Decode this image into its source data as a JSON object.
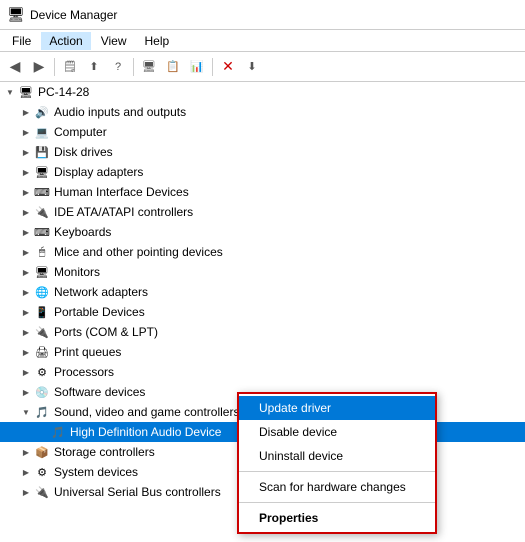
{
  "titleBar": {
    "icon": "🖥",
    "title": "Device Manager"
  },
  "menuBar": {
    "items": [
      {
        "id": "file",
        "label": "File"
      },
      {
        "id": "action",
        "label": "Action",
        "active": true
      },
      {
        "id": "view",
        "label": "View"
      },
      {
        "id": "help",
        "label": "Help"
      }
    ]
  },
  "toolbar": {
    "buttons": [
      "◀",
      "▶",
      "⬜",
      "⬜",
      "?",
      "⬜",
      "🖥",
      "❌",
      "⬇"
    ]
  },
  "tree": {
    "rootLabel": "PC-14-28",
    "items": [
      {
        "id": "audio",
        "label": "Audio inputs and outputs",
        "icon": "audio",
        "indent": 2,
        "expanded": false
      },
      {
        "id": "computer",
        "label": "Computer",
        "icon": "comp",
        "indent": 2,
        "expanded": false
      },
      {
        "id": "disk",
        "label": "Disk drives",
        "icon": "disk",
        "indent": 2,
        "expanded": false
      },
      {
        "id": "display",
        "label": "Display adapters",
        "icon": "display",
        "indent": 2,
        "expanded": false
      },
      {
        "id": "hid",
        "label": "Human Interface Devices",
        "icon": "hid",
        "indent": 2,
        "expanded": false
      },
      {
        "id": "ide",
        "label": "IDE ATA/ATAPI controllers",
        "icon": "ide",
        "indent": 2,
        "expanded": false
      },
      {
        "id": "kbd",
        "label": "Keyboards",
        "icon": "kbd",
        "indent": 2,
        "expanded": false
      },
      {
        "id": "mouse",
        "label": "Mice and other pointing devices",
        "icon": "mouse",
        "indent": 2,
        "expanded": false
      },
      {
        "id": "monitors",
        "label": "Monitors",
        "icon": "monitor",
        "indent": 2,
        "expanded": false
      },
      {
        "id": "net",
        "label": "Network adapters",
        "icon": "net",
        "indent": 2,
        "expanded": false
      },
      {
        "id": "portable",
        "label": "Portable Devices",
        "icon": "port",
        "indent": 2,
        "expanded": false
      },
      {
        "id": "ports",
        "label": "Ports (COM & LPT)",
        "icon": "ports",
        "indent": 2,
        "expanded": false
      },
      {
        "id": "print",
        "label": "Print queues",
        "icon": "print",
        "indent": 2,
        "expanded": false
      },
      {
        "id": "proc",
        "label": "Processors",
        "icon": "cpu",
        "indent": 2,
        "expanded": false
      },
      {
        "id": "sw",
        "label": "Software devices",
        "icon": "sw",
        "indent": 2,
        "expanded": false
      },
      {
        "id": "sound",
        "label": "Sound, video and game controllers",
        "icon": "sound",
        "indent": 2,
        "expanded": true
      },
      {
        "id": "hda",
        "label": "High Definition Audio Device",
        "icon": "audio-dev",
        "indent": 4,
        "expanded": false,
        "selected": true
      },
      {
        "id": "storage",
        "label": "Storage controllers",
        "icon": "storage",
        "indent": 2,
        "expanded": false
      },
      {
        "id": "sys",
        "label": "System devices",
        "icon": "sys",
        "indent": 2,
        "expanded": false
      },
      {
        "id": "usb",
        "label": "Universal Serial Bus controllers",
        "icon": "usb",
        "indent": 2,
        "expanded": false
      }
    ]
  },
  "contextMenu": {
    "items": [
      {
        "id": "update",
        "label": "Update driver",
        "highlighted": true
      },
      {
        "id": "disable",
        "label": "Disable device"
      },
      {
        "id": "uninstall",
        "label": "Uninstall device"
      },
      {
        "id": "scan",
        "label": "Scan for hardware changes"
      },
      {
        "id": "props",
        "label": "Properties",
        "bold": true
      }
    ]
  }
}
